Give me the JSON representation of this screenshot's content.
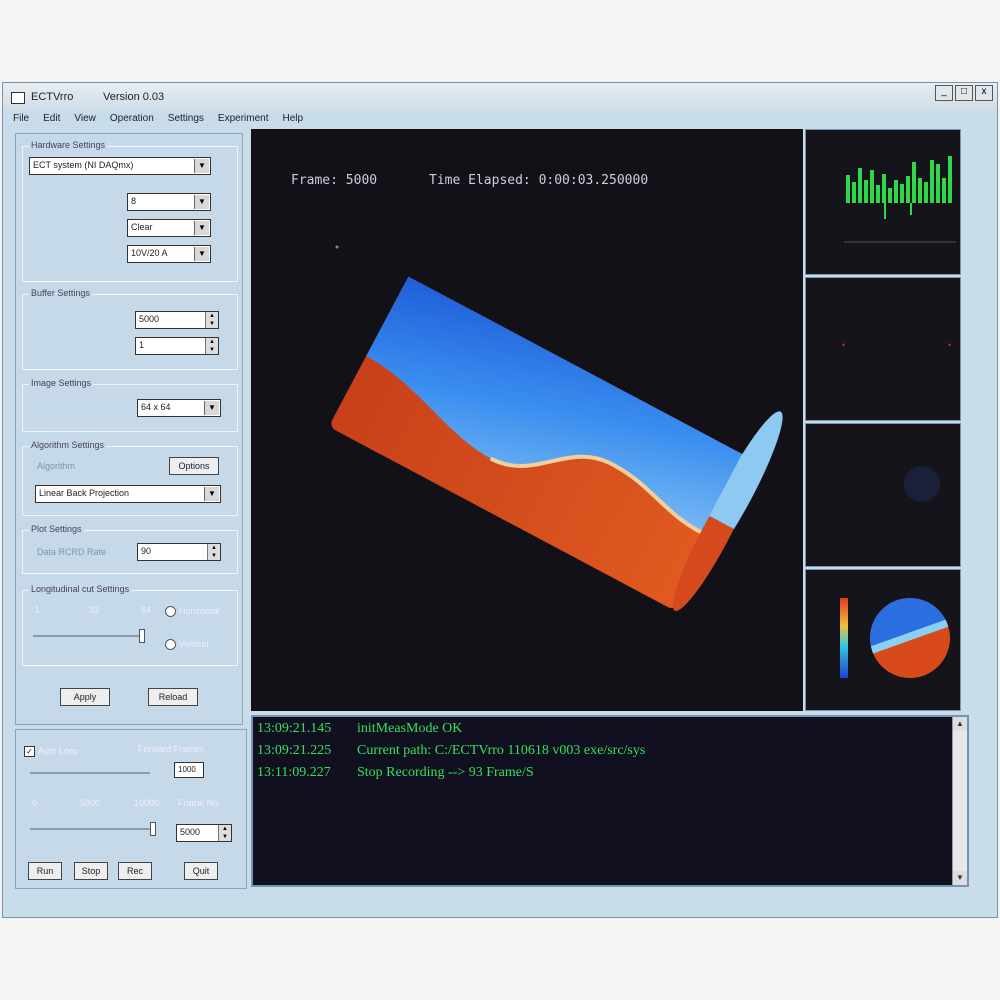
{
  "window": {
    "title": "ECTVrro",
    "version": "Version 0.03",
    "controls": [
      "_",
      "□",
      "x"
    ]
  },
  "menu": [
    "File",
    "Edit",
    "View",
    "Operation",
    "Settings",
    "Experiment",
    "Help"
  ],
  "left": {
    "hardware": {
      "label": "Hardware Settings",
      "system": "ECT system (NI DAQmx)",
      "sensors": "8",
      "frames": "Clear",
      "volts": "10V/20 A"
    },
    "buffer": {
      "label": "Buffer Settings",
      "frames_in_buffer": "5000",
      "image_buffer": "1"
    },
    "image": {
      "label": "Image Settings",
      "resolution": "64 x 64"
    },
    "algorithm": {
      "label": "Algorithm Settings",
      "algorithm_label": "Algorithm",
      "options_button": "Options",
      "method": "Linear Back Projection"
    },
    "plot": {
      "label": "Plot Settings",
      "rate_label": "Data RCRD Rate",
      "rate": "90"
    },
    "longitudinal": {
      "label": "Longitudinal cut Settings",
      "ticks": [
        "1",
        "33",
        "64"
      ],
      "horizontal": "Horizontal",
      "vertical": "Vertical"
    },
    "apply_button": "Apply",
    "reload_button": "Reload"
  },
  "playback": {
    "auto_loop": "Auto Loop",
    "forward_frames_label": "Forward Frames",
    "forward_frames_value": "1000",
    "scale": [
      "0",
      "5000",
      "10000"
    ],
    "frame_no_label": "Frame No",
    "frame_no_value": "5000",
    "buttons": [
      "Run",
      "Stop",
      "Rec",
      "Quit"
    ]
  },
  "view": {
    "frame": "Frame: 5000",
    "elapsed": "Time Elapsed: 0:00:03.250000"
  },
  "log": [
    {
      "time": "13:09:21.145",
      "msg": "initMeasMode OK"
    },
    {
      "time": "13:09:21.225",
      "msg": "Current path: C:/ECTVrro 110618 v003 exe/src/sys"
    },
    {
      "time": "13:11:09.227",
      "msg": "Stop Recording --> 93 Frame/S"
    }
  ],
  "colors": {
    "accent": "#36e05a",
    "panel": "#c6d9e8",
    "view_bg": "#121118"
  }
}
